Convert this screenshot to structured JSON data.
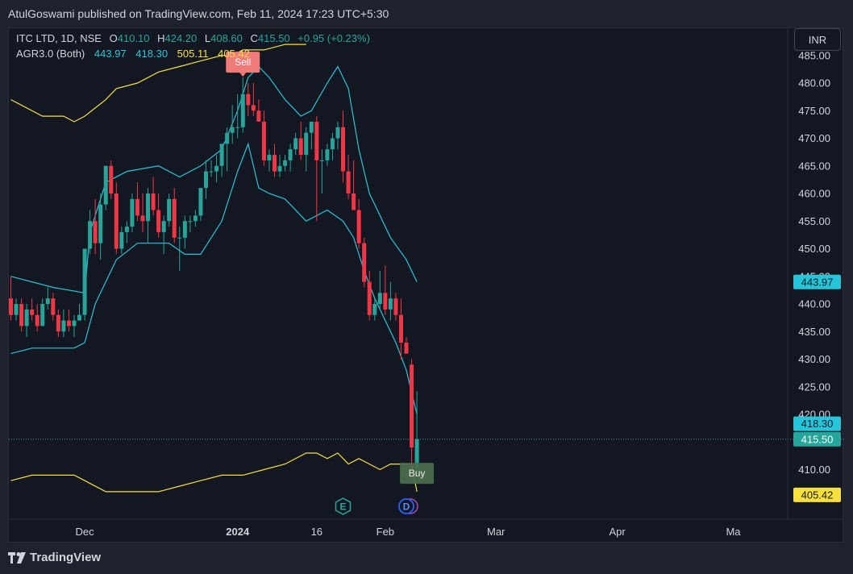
{
  "publisher_line": "AtulGoswami published on TradingView.com, Feb 11, 2024 17:23 UTC+5:30",
  "legend": {
    "title": "ITC LTD, 1D, NSE",
    "o_label": "O",
    "o_value": "410.10",
    "h_label": "H",
    "h_value": "424.20",
    "l_label": "L",
    "l_value": "408.60",
    "c_label": "C",
    "c_value": "415.50",
    "change": "+0.95 (+0.23%)",
    "indicator_name": "AGR3.0 (Both)",
    "ind_values": [
      "443.97",
      "418.30",
      "505.11",
      "405.42"
    ]
  },
  "currency_button": "INR",
  "footer_brand": "TradingView",
  "colors": {
    "up": "#26a69a",
    "down": "#f23645",
    "band": "#26c6da",
    "envelope": "#f7e03c",
    "background": "#131722"
  },
  "chart_data": {
    "type": "candlestick",
    "symbol": "ITC LTD",
    "interval": "1D",
    "exchange": "NSE",
    "ylim": [
      403,
      486
    ],
    "y_ticks": [
      "410.00",
      "415.00",
      "420.00",
      "425.00",
      "430.00",
      "435.00",
      "440.00",
      "445.00",
      "450.00",
      "455.00",
      "460.00",
      "465.00",
      "470.00",
      "475.00",
      "480.00",
      "485.00"
    ],
    "x_ticks": [
      {
        "label": "Dec",
        "idx": 14,
        "bold": false
      },
      {
        "label": "2024",
        "idx": 43,
        "bold": true
      },
      {
        "label": "16",
        "idx": 58,
        "bold": false
      },
      {
        "label": "Feb",
        "idx": 71,
        "bold": false
      },
      {
        "label": "Mar",
        "idx": 92,
        "bold": false
      },
      {
        "label": "Apr",
        "idx": 115,
        "bold": false
      },
      {
        "label": "Ma",
        "idx": 137,
        "bold": false
      }
    ],
    "candles": [
      {
        "o": 441,
        "h": 445,
        "l": 437,
        "c": 438
      },
      {
        "o": 438,
        "h": 441,
        "l": 437,
        "c": 440
      },
      {
        "o": 440,
        "h": 441,
        "l": 435,
        "c": 436
      },
      {
        "o": 436,
        "h": 440,
        "l": 434,
        "c": 439
      },
      {
        "o": 439,
        "h": 441,
        "l": 437,
        "c": 438
      },
      {
        "o": 438,
        "h": 440,
        "l": 435,
        "c": 436
      },
      {
        "o": 436,
        "h": 441,
        "l": 436,
        "c": 440
      },
      {
        "o": 440,
        "h": 443,
        "l": 439,
        "c": 441
      },
      {
        "o": 441,
        "h": 442,
        "l": 437,
        "c": 438
      },
      {
        "o": 438,
        "h": 439,
        "l": 434,
        "c": 435
      },
      {
        "o": 435,
        "h": 439,
        "l": 434,
        "c": 437
      },
      {
        "o": 437,
        "h": 439,
        "l": 435,
        "c": 436
      },
      {
        "o": 436,
        "h": 438,
        "l": 434,
        "c": 437
      },
      {
        "o": 437,
        "h": 440,
        "l": 437,
        "c": 438
      },
      {
        "o": 438,
        "h": 450,
        "l": 437,
        "c": 450
      },
      {
        "o": 450,
        "h": 457,
        "l": 449,
        "c": 455
      },
      {
        "o": 455,
        "h": 459,
        "l": 449,
        "c": 451
      },
      {
        "o": 451,
        "h": 460,
        "l": 448,
        "c": 458
      },
      {
        "o": 458,
        "h": 465,
        "l": 457,
        "c": 465
      },
      {
        "o": 465,
        "h": 466,
        "l": 459,
        "c": 460
      },
      {
        "o": 460,
        "h": 462,
        "l": 449,
        "c": 450
      },
      {
        "o": 450,
        "h": 454,
        "l": 449,
        "c": 453
      },
      {
        "o": 453,
        "h": 455,
        "l": 451,
        "c": 454
      },
      {
        "o": 454,
        "h": 460,
        "l": 453,
        "c": 459
      },
      {
        "o": 459,
        "h": 462,
        "l": 455,
        "c": 456
      },
      {
        "o": 456,
        "h": 460,
        "l": 453,
        "c": 455
      },
      {
        "o": 455,
        "h": 461,
        "l": 451,
        "c": 460
      },
      {
        "o": 460,
        "h": 463,
        "l": 456,
        "c": 457
      },
      {
        "o": 457,
        "h": 460,
        "l": 452,
        "c": 453
      },
      {
        "o": 453,
        "h": 456,
        "l": 449,
        "c": 455
      },
      {
        "o": 455,
        "h": 460,
        "l": 454,
        "c": 459
      },
      {
        "o": 459,
        "h": 461,
        "l": 451,
        "c": 452
      },
      {
        "o": 452,
        "h": 454,
        "l": 446,
        "c": 452
      },
      {
        "o": 452,
        "h": 456,
        "l": 450,
        "c": 455
      },
      {
        "o": 455,
        "h": 456,
        "l": 453,
        "c": 455
      },
      {
        "o": 455,
        "h": 457,
        "l": 454,
        "c": 456
      },
      {
        "o": 456,
        "h": 461,
        "l": 455,
        "c": 461
      },
      {
        "o": 461,
        "h": 466,
        "l": 459,
        "c": 464
      },
      {
        "o": 464,
        "h": 466,
        "l": 463,
        "c": 464
      },
      {
        "o": 464,
        "h": 467,
        "l": 462,
        "c": 465
      },
      {
        "o": 465,
        "h": 469,
        "l": 463,
        "c": 469
      },
      {
        "o": 469,
        "h": 472,
        "l": 464,
        "c": 471
      },
      {
        "o": 471,
        "h": 476,
        "l": 469,
        "c": 472
      },
      {
        "o": 472,
        "h": 478,
        "l": 470,
        "c": 472
      },
      {
        "o": 472,
        "h": 481,
        "l": 471,
        "c": 478
      },
      {
        "o": 478,
        "h": 480,
        "l": 474,
        "c": 476
      },
      {
        "o": 476,
        "h": 480,
        "l": 474,
        "c": 475
      },
      {
        "o": 475,
        "h": 477,
        "l": 473,
        "c": 473
      },
      {
        "o": 473,
        "h": 475,
        "l": 465,
        "c": 466
      },
      {
        "o": 466,
        "h": 468,
        "l": 464,
        "c": 467
      },
      {
        "o": 467,
        "h": 469,
        "l": 463,
        "c": 464
      },
      {
        "o": 464,
        "h": 467,
        "l": 463,
        "c": 465
      },
      {
        "o": 465,
        "h": 467,
        "l": 464,
        "c": 466
      },
      {
        "o": 466,
        "h": 469,
        "l": 464,
        "c": 468
      },
      {
        "o": 468,
        "h": 471,
        "l": 467,
        "c": 470
      },
      {
        "o": 470,
        "h": 473,
        "l": 466,
        "c": 467
      },
      {
        "o": 467,
        "h": 472,
        "l": 464,
        "c": 471
      },
      {
        "o": 471,
        "h": 473,
        "l": 468,
        "c": 473
      },
      {
        "o": 473,
        "h": 474,
        "l": 455,
        "c": 466
      },
      {
        "o": 466,
        "h": 468,
        "l": 460,
        "c": 466
      },
      {
        "o": 466,
        "h": 469,
        "l": 465,
        "c": 468
      },
      {
        "o": 468,
        "h": 471,
        "l": 466,
        "c": 470
      },
      {
        "o": 470,
        "h": 473,
        "l": 468,
        "c": 472
      },
      {
        "o": 472,
        "h": 475,
        "l": 462,
        "c": 464
      },
      {
        "o": 464,
        "h": 467,
        "l": 459,
        "c": 460
      },
      {
        "o": 460,
        "h": 466,
        "l": 457,
        "c": 457
      },
      {
        "o": 457,
        "h": 459,
        "l": 450,
        "c": 451
      },
      {
        "o": 451,
        "h": 452,
        "l": 443,
        "c": 444
      },
      {
        "o": 444,
        "h": 446,
        "l": 437,
        "c": 438
      },
      {
        "o": 438,
        "h": 441,
        "l": 437,
        "c": 440
      },
      {
        "o": 440,
        "h": 446,
        "l": 439,
        "c": 442
      },
      {
        "o": 442,
        "h": 447,
        "l": 438,
        "c": 439
      },
      {
        "o": 439,
        "h": 444,
        "l": 437,
        "c": 441
      },
      {
        "o": 441,
        "h": 442,
        "l": 437,
        "c": 438
      },
      {
        "o": 438,
        "h": 441,
        "l": 430,
        "c": 433
      },
      {
        "o": 433,
        "h": 434,
        "l": 431,
        "c": 431
      },
      {
        "o": 429,
        "h": 430,
        "l": 410,
        "c": 414
      },
      {
        "o": 410.1,
        "h": 424.2,
        "l": 408.6,
        "c": 415.5
      }
    ],
    "bands": {
      "upper": [
        [
          0,
          445
        ],
        [
          8,
          443
        ],
        [
          14,
          442
        ],
        [
          15,
          453
        ],
        [
          18,
          462
        ],
        [
          22,
          464
        ],
        [
          28,
          465
        ],
        [
          32,
          463
        ],
        [
          36,
          465
        ],
        [
          40,
          468
        ],
        [
          43,
          475
        ],
        [
          45,
          481
        ],
        [
          47,
          483
        ],
        [
          49,
          481
        ],
        [
          52,
          477
        ],
        [
          55,
          474
        ],
        [
          57,
          475
        ],
        [
          60,
          480
        ],
        [
          62,
          483
        ],
        [
          64,
          479
        ],
        [
          66,
          468
        ],
        [
          68,
          460
        ],
        [
          72,
          452
        ],
        [
          75,
          448
        ],
        [
          77,
          444
        ]
      ],
      "lower": [
        [
          0,
          431
        ],
        [
          4,
          432
        ],
        [
          12,
          432
        ],
        [
          14,
          433
        ],
        [
          16,
          440
        ],
        [
          20,
          448
        ],
        [
          24,
          451
        ],
        [
          30,
          451
        ],
        [
          33,
          449
        ],
        [
          36,
          449
        ],
        [
          40,
          455
        ],
        [
          43,
          464
        ],
        [
          45,
          469
        ],
        [
          47,
          461
        ],
        [
          49,
          460
        ],
        [
          52,
          459
        ],
        [
          54,
          457
        ],
        [
          56,
          455
        ],
        [
          58,
          456
        ],
        [
          60,
          457
        ],
        [
          63,
          455
        ],
        [
          65,
          452
        ],
        [
          67,
          446
        ],
        [
          69,
          441
        ],
        [
          73,
          433
        ],
        [
          75,
          428
        ],
        [
          77,
          420
        ]
      ],
      "upper_env": [
        [
          0,
          477
        ],
        [
          6,
          474
        ],
        [
          10,
          474
        ],
        [
          12,
          473
        ],
        [
          14,
          474
        ],
        [
          18,
          477
        ],
        [
          20,
          479
        ],
        [
          24,
          480
        ],
        [
          28,
          482
        ],
        [
          32,
          483
        ],
        [
          36,
          484
        ],
        [
          40,
          485
        ],
        [
          42,
          485
        ],
        [
          44,
          486
        ],
        [
          48,
          486
        ],
        [
          52,
          487
        ],
        [
          56,
          487
        ]
      ],
      "lower_env": [
        [
          0,
          408
        ],
        [
          4,
          409
        ],
        [
          10,
          409
        ],
        [
          12,
          409
        ],
        [
          14,
          408
        ],
        [
          18,
          406
        ],
        [
          20,
          406
        ],
        [
          24,
          406
        ],
        [
          28,
          406
        ],
        [
          32,
          407
        ],
        [
          36,
          408
        ],
        [
          40,
          409
        ],
        [
          44,
          409
        ],
        [
          48,
          410
        ],
        [
          52,
          411
        ],
        [
          56,
          413
        ],
        [
          58,
          413
        ],
        [
          60,
          412
        ],
        [
          62,
          413
        ],
        [
          64,
          411
        ],
        [
          66,
          412
        ],
        [
          68,
          411
        ],
        [
          70,
          410
        ],
        [
          72,
          411
        ],
        [
          74,
          411
        ],
        [
          76,
          411
        ],
        [
          77,
          406
        ]
      ]
    },
    "signals": [
      {
        "label": "Sell",
        "idx": 44
      },
      {
        "label": "Buy",
        "idx": 77
      }
    ],
    "events": [
      {
        "label": "E",
        "idx": 63
      },
      {
        "label": "D",
        "idx": 75
      }
    ],
    "price_tags": [
      {
        "label": "443.97",
        "price": 443.97,
        "color": "#26c6da"
      },
      {
        "label": "418.30",
        "price": 418.3,
        "color": "#26c6da"
      },
      {
        "label": "415.50",
        "price": 415.5,
        "color": "#26a69a"
      },
      {
        "label": "405.42",
        "price": 405.42,
        "color": "#f7e03c"
      }
    ],
    "last_price": 415.5,
    "grid": false
  }
}
